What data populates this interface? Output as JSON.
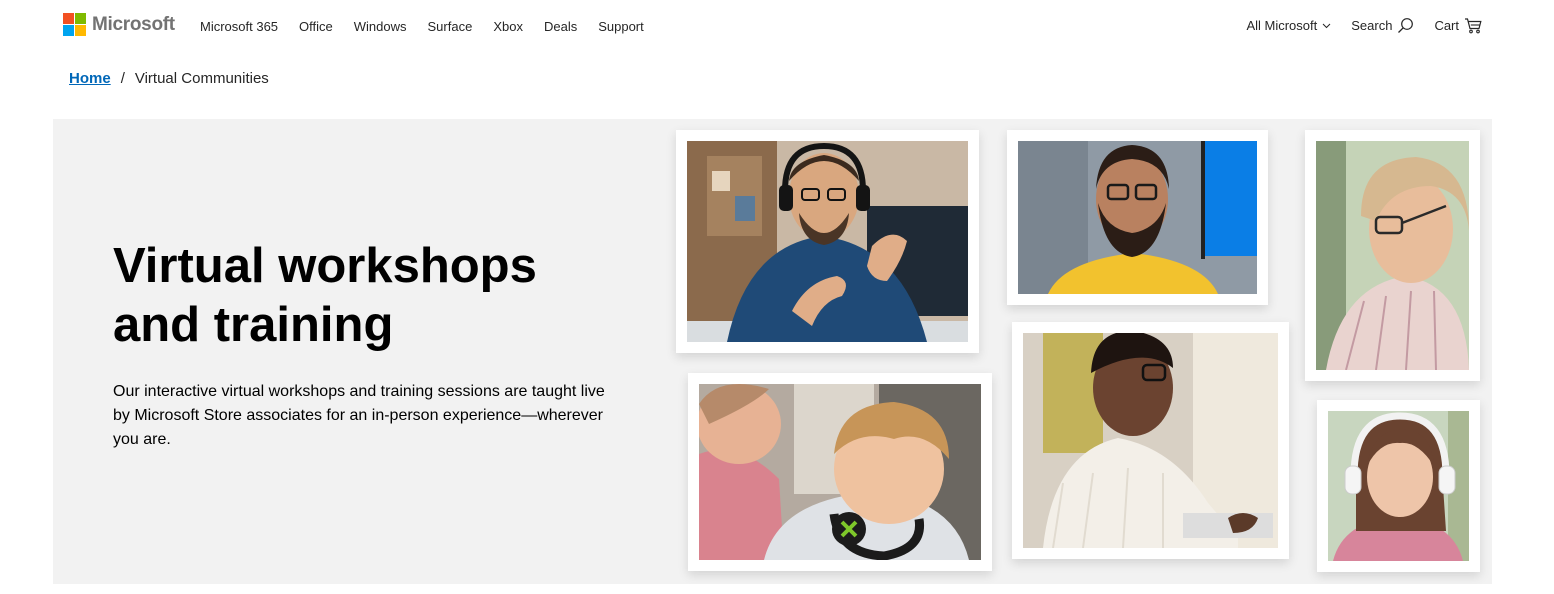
{
  "brand": {
    "name": "Microsoft",
    "colors": [
      "#f25022",
      "#7fba00",
      "#00a4ef",
      "#ffb900"
    ]
  },
  "nav": {
    "items": [
      "Microsoft 365",
      "Office",
      "Windows",
      "Surface",
      "Xbox",
      "Deals",
      "Support"
    ]
  },
  "right_nav": {
    "all_microsoft": "All Microsoft",
    "search": "Search",
    "cart": "Cart",
    "icons": [
      "chevron-down-icon",
      "search-icon",
      "cart-icon"
    ]
  },
  "breadcrumb": {
    "home": "Home",
    "separator": "/",
    "current": "Virtual Communities"
  },
  "hero": {
    "title_line1": "Virtual workshops",
    "title_line2": "and training",
    "body": "Our interactive virtual workshops and training sessions are taught live by Microsoft Store associates for an in-person experience—wherever you are.",
    "background": "#f2f2f2"
  },
  "accent": {
    "link": "#0067b8"
  }
}
